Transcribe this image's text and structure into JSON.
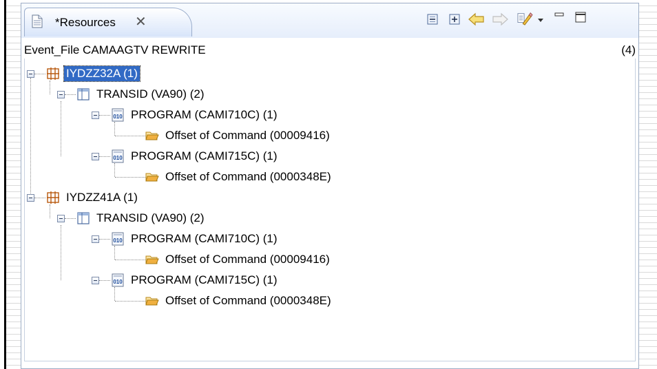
{
  "view": {
    "tab_label": "*Resources",
    "tab_close_glyph": "✕",
    "header_title": "Event_File CAMAAGTV REWRITE",
    "header_count": "(4)"
  },
  "toolbar": {
    "items": [
      {
        "name": "collapse-all-icon"
      },
      {
        "name": "expand-all-icon"
      },
      {
        "name": "back-arrow-icon"
      },
      {
        "name": "forward-arrow-icon"
      },
      {
        "name": "filter-icon"
      },
      {
        "name": "view-menu-chevron-icon"
      },
      {
        "name": "minimize-icon"
      },
      {
        "name": "maximize-icon"
      }
    ]
  },
  "tree": {
    "nodes": [
      {
        "label": "IYDZZ32A  (1)",
        "type": "resource",
        "selected": true
      },
      {
        "label": "TRANSID (VA90)  (2)",
        "type": "transid"
      },
      {
        "label": "PROGRAM (CAMI710C)  (1)",
        "type": "program"
      },
      {
        "label": "Offset of Command (00009416)",
        "type": "offset"
      },
      {
        "label": "PROGRAM (CAMI715C)  (1)",
        "type": "program"
      },
      {
        "label": "Offset of Command (0000348E)",
        "type": "offset"
      },
      {
        "label": "IYDZZ41A  (1)",
        "type": "resource",
        "selected": false
      },
      {
        "label": "TRANSID (VA90)  (2)",
        "type": "transid"
      },
      {
        "label": "PROGRAM (CAMI710C)  (1)",
        "type": "program"
      },
      {
        "label": "Offset of Command (00009416)",
        "type": "offset"
      },
      {
        "label": "PROGRAM (CAMI715C)  (1)",
        "type": "program"
      },
      {
        "label": "Offset of Command (0000348E)",
        "type": "offset"
      }
    ]
  },
  "colors": {
    "selection": "#316ac5",
    "tab_border": "#9aadcc",
    "folder": "#f0b040",
    "resource_icon": "#b85a10"
  }
}
